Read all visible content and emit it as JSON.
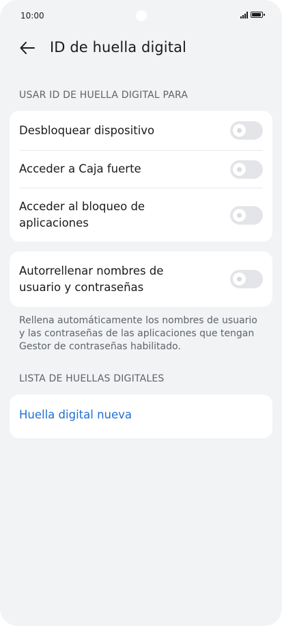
{
  "status_bar": {
    "time": "10:00"
  },
  "header": {
    "title": "ID de huella digital",
    "back_icon": "arrow-left-icon"
  },
  "sections": {
    "use_for": {
      "label": "USAR ID DE HUELLA DIGITAL PARA",
      "items": [
        {
          "label": "Desbloquear dispositivo",
          "enabled": false
        },
        {
          "label": "Acceder a Caja fuerte",
          "enabled": false
        },
        {
          "label": "Acceder al bloqueo de aplicaciones",
          "enabled": false
        }
      ]
    },
    "autofill": {
      "label": "Autorrellenar nombres de usuario y contraseñas",
      "enabled": false,
      "description": "Rellena automáticamente los nombres de usuario y las contraseñas de las aplicaciones que tengan Gestor de contraseñas habilitado."
    },
    "fingerprint_list": {
      "label": "LISTA DE HUELLAS DIGITALES",
      "new_fingerprint": "Huella digital nueva"
    }
  },
  "colors": {
    "background": "#f1f3f5",
    "card": "#ffffff",
    "link": "#1f6fd1",
    "toggle_off": "#e3e5e8"
  }
}
